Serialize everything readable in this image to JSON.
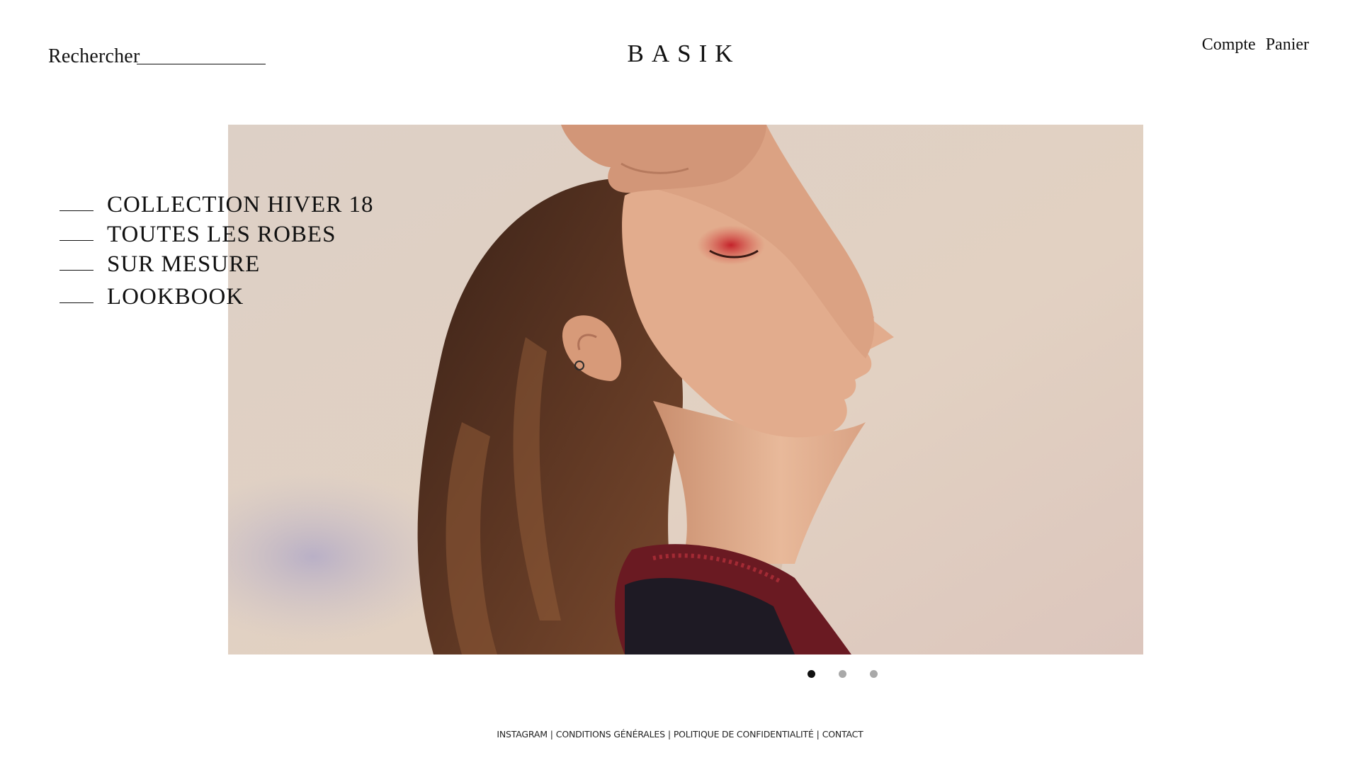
{
  "header": {
    "search_label": "Rechercher",
    "search_value": "",
    "logo": "BASIK",
    "account_label": "Compte",
    "cart_label": "Panier"
  },
  "menu": {
    "items": [
      {
        "label": "COLLECTION HIVER 18"
      },
      {
        "label": "TOUTES LES ROBES"
      },
      {
        "label": "SUR MESURE"
      },
      {
        "label": "LOOKBOOK"
      }
    ]
  },
  "hero": {
    "image": "fashion-model-portrait",
    "background_color": "#e0d2c6"
  },
  "carousel": {
    "slide_count": 3,
    "active_index": 0
  },
  "footer": {
    "links": [
      "INSTAGRAM",
      "CONDITIONS GÉNÉRALES",
      "POLITIQUE DE CONFIDENTIALITÉ",
      "CONTACT"
    ],
    "separator": "|"
  }
}
